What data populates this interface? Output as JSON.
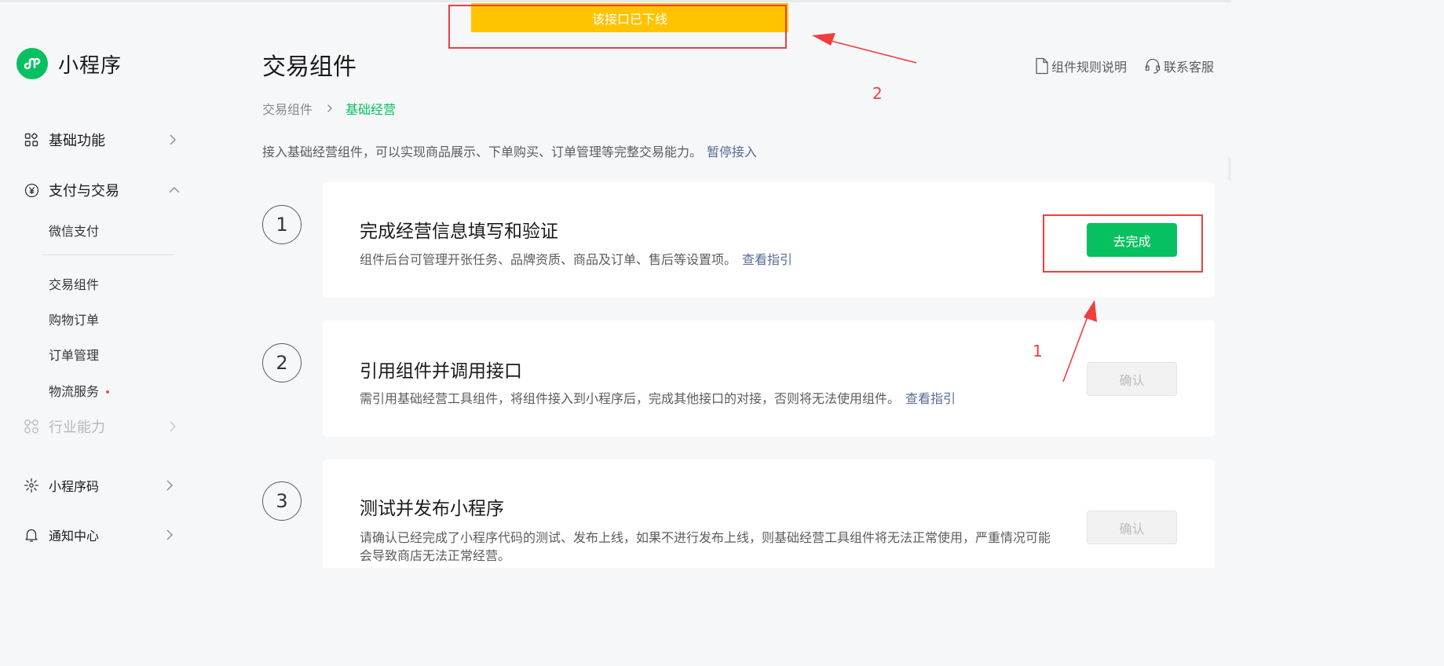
{
  "brand": {
    "name": "小程序",
    "accent": "#07c160"
  },
  "sidebar": {
    "items": [
      {
        "label": "基础功能",
        "icon": "grid-icon"
      },
      {
        "label": "支付与交易",
        "icon": "yuan-icon"
      },
      {
        "label": "行业能力",
        "icon": "industry-icon"
      },
      {
        "label": "小程序码",
        "icon": "qrcode-icon"
      },
      {
        "label": "通知中心",
        "icon": "bell-icon"
      }
    ],
    "payment_subitems": [
      {
        "label": "微信支付"
      },
      {
        "label": "交易组件"
      },
      {
        "label": "购物订单"
      },
      {
        "label": "订单管理"
      },
      {
        "label": "物流服务"
      }
    ]
  },
  "header": {
    "title": "交易组件",
    "breadcrumb": {
      "root": "交易组件",
      "current": "基础经营"
    },
    "intro": "接入基础经营组件，可以实现商品展示、下单购买、订单管理等完整交易能力。",
    "pause_link": "暂停接入",
    "links": {
      "rules": "组件规则说明",
      "support": "联系客服"
    }
  },
  "banner": {
    "text": "该接口已下线",
    "color": "#ffc300"
  },
  "steps": [
    {
      "number": "1",
      "title": "完成经营信息填写和验证",
      "desc": "组件后台可管理开张任务、品牌资质、商品及订单、售后等设置项。",
      "link": "查看指引",
      "button": "去完成"
    },
    {
      "number": "2",
      "title": "引用组件并调用接口",
      "desc": "需引用基础经营工具组件，将组件接入到小程序后，完成其他接口的对接，否则将无法使用组件。",
      "link": "查看指引",
      "button": "确认"
    },
    {
      "number": "3",
      "title": "测试并发布小程序",
      "desc": "请确认已经完成了小程序代码的测试、发布上线，如果不进行发布上线，则基础经营工具组件将无法正常使用，严重情况可能会导致商店无法正常经营。",
      "button": "确认"
    }
  ],
  "annotations": {
    "label_1": "1",
    "label_2": "2",
    "color": "#ee3f3f"
  }
}
